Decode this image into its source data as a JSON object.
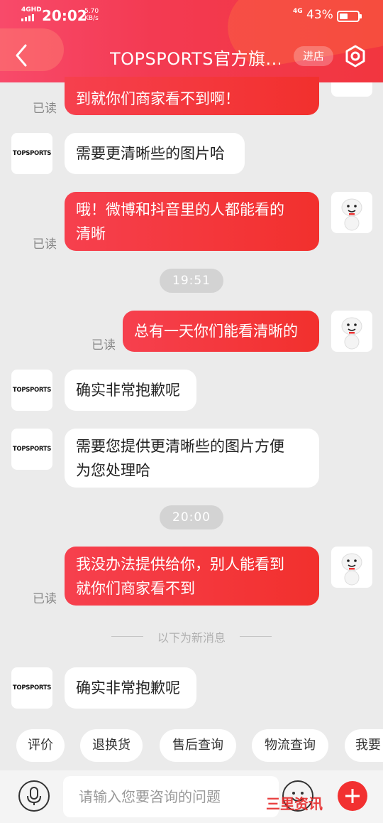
{
  "status_bar": {
    "network": "4GHD",
    "time": "20:02",
    "speed_value": "5.70",
    "speed_unit": "KB/s",
    "net_type": "4G",
    "battery": "43%"
  },
  "header": {
    "title": "TOPSPORTS官方旗...",
    "enter_shop": "进店"
  },
  "shop_logo": "TOPSPORTS",
  "messages": {
    "m0": {
      "text": "到就你们商家看不到啊！",
      "read": "已读"
    },
    "m1": {
      "text": "需要更清晰些的图片哈"
    },
    "m2": {
      "text1": "哦！微博和抖音里的人都能看的",
      "text2": "清晰",
      "read": "已读"
    },
    "t1": "19:51",
    "m3": {
      "text": "总有一天你们能看清晰的",
      "read": "已读"
    },
    "m4": {
      "text": "确实非常抱歉呢"
    },
    "m5": {
      "text1": "需要您提供更清晰些的图片方便",
      "text2": "为您处理哈"
    },
    "t2": "20:00",
    "m6": {
      "text1": "我没办法提供给你，别人能看到",
      "text2": "就你们商家看不到",
      "read": "已读"
    },
    "divider": "以下为新消息",
    "m7": {
      "text": "确实非常抱歉呢"
    }
  },
  "quick_actions": [
    "评价",
    "退换货",
    "售后查询",
    "物流查询",
    "我要"
  ],
  "input": {
    "placeholder": "请输入您要咨询的问题"
  },
  "watermark": "三里资讯"
}
